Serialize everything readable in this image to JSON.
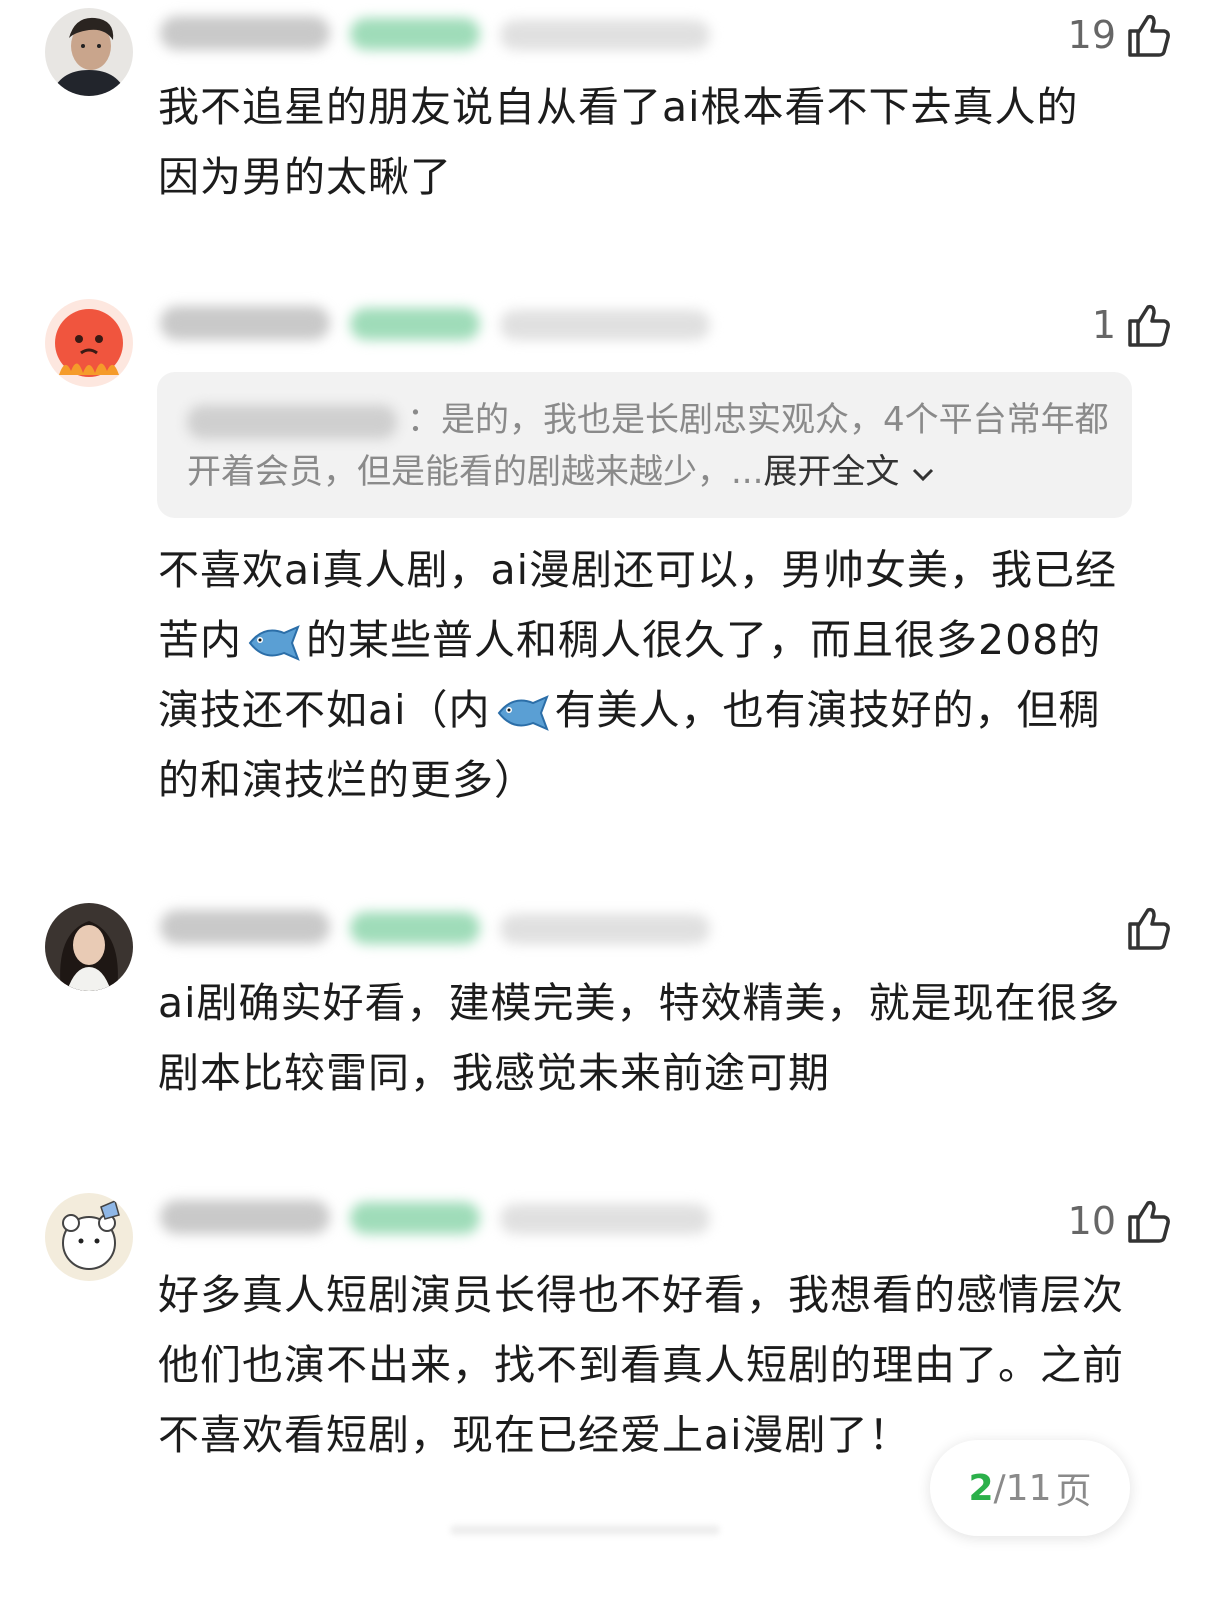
{
  "comments": [
    {
      "likes": "19",
      "text": "我不追星的朋友说自从看了ai根本看不下去真人的 因为男的太瞅了"
    },
    {
      "likes": "1",
      "reply_separator": "：",
      "reply_text": "是的，我也是长剧忠实观众，4个平台常年都开着会员，但是能看的剧越来越少，...",
      "reply_expand": "展开全文",
      "text_parts": [
        "不喜欢ai真人剧，ai漫剧还可以，男帅女美，我已经苦内",
        "的某些普人和稠人很久了，而且很多208的演技还不如ai（内",
        "有美人，也有演技好的，但稠的和演技烂的更多）"
      ]
    },
    {
      "likes": "",
      "text": "ai剧确实好看，建模完美，特效精美，就是现在很多剧本比较雷同，我感觉未来前途可期"
    },
    {
      "likes": "10",
      "text": "好多真人短剧演员长得也不好看，我想看的感情层次他们也演不出来，找不到看真人短剧的理由了。之前不喜欢看短剧，现在已经爱上ai漫剧了！"
    }
  ],
  "pager": {
    "current": "2",
    "total": "/11",
    "unit": "页"
  },
  "colors": {
    "accent": "#2bb04a",
    "muted": "#8a8a8a",
    "text": "#1c1c1c",
    "quote_bg": "#f2f2f2"
  }
}
